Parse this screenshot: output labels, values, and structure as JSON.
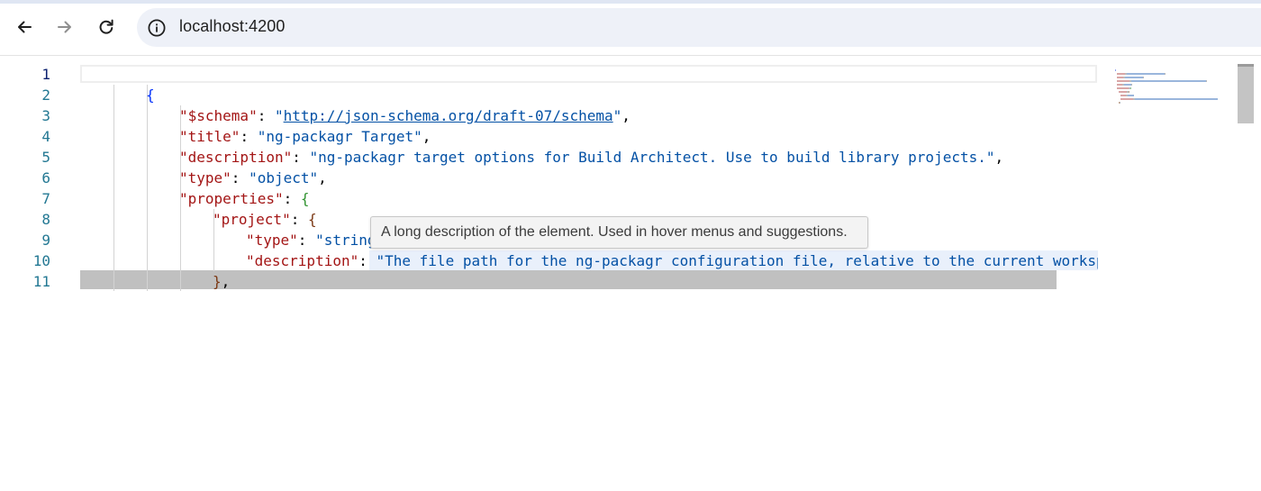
{
  "browser": {
    "url": "localhost:4200",
    "icons": {
      "back": "arrow-left-icon",
      "forward": "arrow-right-icon",
      "reload": "reload-icon",
      "site_info": "info-circle-icon"
    },
    "colors": {
      "omnibox_bg": "#eef1f8",
      "icon": "#1f1f1f",
      "icon_disabled": "#8f8f8f"
    }
  },
  "editor": {
    "language": "json",
    "current_line": 1,
    "line_numbers": [
      "1",
      "2",
      "3",
      "4",
      "5",
      "6",
      "7",
      "8",
      "9",
      "10",
      "11"
    ],
    "lines": [
      [],
      [
        {
          "t": "{",
          "c": "b1"
        }
      ],
      [
        {
          "t": "\"$schema\"",
          "c": "key"
        },
        {
          "t": ": ",
          "c": "punc"
        },
        {
          "t": "\"",
          "c": "str"
        },
        {
          "t": "http://json-schema.org/draft-07/schema",
          "c": "url"
        },
        {
          "t": "\"",
          "c": "str"
        },
        {
          "t": ",",
          "c": "punc"
        }
      ],
      [
        {
          "t": "\"title\"",
          "c": "key"
        },
        {
          "t": ": ",
          "c": "punc"
        },
        {
          "t": "\"ng-packagr Target\"",
          "c": "str"
        },
        {
          "t": ",",
          "c": "punc"
        }
      ],
      [
        {
          "t": "\"description\"",
          "c": "key"
        },
        {
          "t": ": ",
          "c": "punc"
        },
        {
          "t": "\"ng-packagr target options for Build Architect. Use to build library projects.\"",
          "c": "str"
        },
        {
          "t": ",",
          "c": "punc"
        }
      ],
      [
        {
          "t": "\"type\"",
          "c": "key"
        },
        {
          "t": ": ",
          "c": "punc"
        },
        {
          "t": "\"object\"",
          "c": "str"
        },
        {
          "t": ",",
          "c": "punc"
        }
      ],
      [
        {
          "t": "\"properties\"",
          "c": "key"
        },
        {
          "t": ": ",
          "c": "punc"
        },
        {
          "t": "{",
          "c": "b2"
        }
      ],
      [
        {
          "t": "\"project\"",
          "c": "key"
        },
        {
          "t": ": ",
          "c": "punc"
        },
        {
          "t": "{",
          "c": "b3"
        }
      ],
      [
        {
          "t": "\"type\"",
          "c": "key"
        },
        {
          "t": ": ",
          "c": "punc"
        },
        {
          "t": "\"string",
          "c": "str"
        }
      ],
      [
        {
          "t": "\"description\"",
          "c": "key"
        },
        {
          "t": ": ",
          "c": "punc"
        },
        {
          "t": "\"The file path for the ng-packagr configuration file, relative to the current workspace.",
          "c": "str"
        }
      ],
      [
        {
          "t": "}",
          "c": "b3"
        },
        {
          "t": ",",
          "c": "punc"
        }
      ]
    ],
    "tooltip": "A long description of the element. Used in hover menus and suggestions.",
    "colors": {
      "line_number": "#237893",
      "key": "#a31515",
      "string": "#0451a5",
      "bracket_level_1": "#0431fa",
      "bracket_level_2": "#319331",
      "bracket_level_3": "#7b3814",
      "selection": "#c0c0c0",
      "tooltip_bg": "#f3f3f3"
    }
  }
}
